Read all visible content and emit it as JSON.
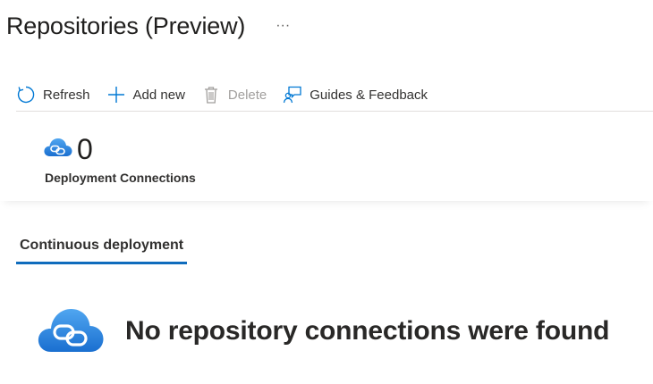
{
  "header": {
    "title": "Repositories (Preview)",
    "more_label": "···"
  },
  "toolbar": {
    "refresh_label": "Refresh",
    "add_label": "Add new",
    "delete_label": "Delete",
    "guides_label": "Guides & Feedback"
  },
  "summary": {
    "count": "0",
    "label": "Deployment Connections"
  },
  "tabs": [
    {
      "label": "Continuous deployment",
      "selected": true
    }
  ],
  "empty_state": {
    "message": "No repository connections were found"
  },
  "colors": {
    "accent": "#0f6cbd",
    "icon_blue": "#0078d4",
    "disabled": "#a19f9d",
    "cloud_light": "#50a6f0",
    "cloud_dark": "#1a6fd0"
  },
  "icons": {
    "refresh": "refresh-icon",
    "add": "plus-icon",
    "delete": "trash-icon",
    "guides": "feedback-person-icon",
    "connections": "cloud-link-icon"
  }
}
